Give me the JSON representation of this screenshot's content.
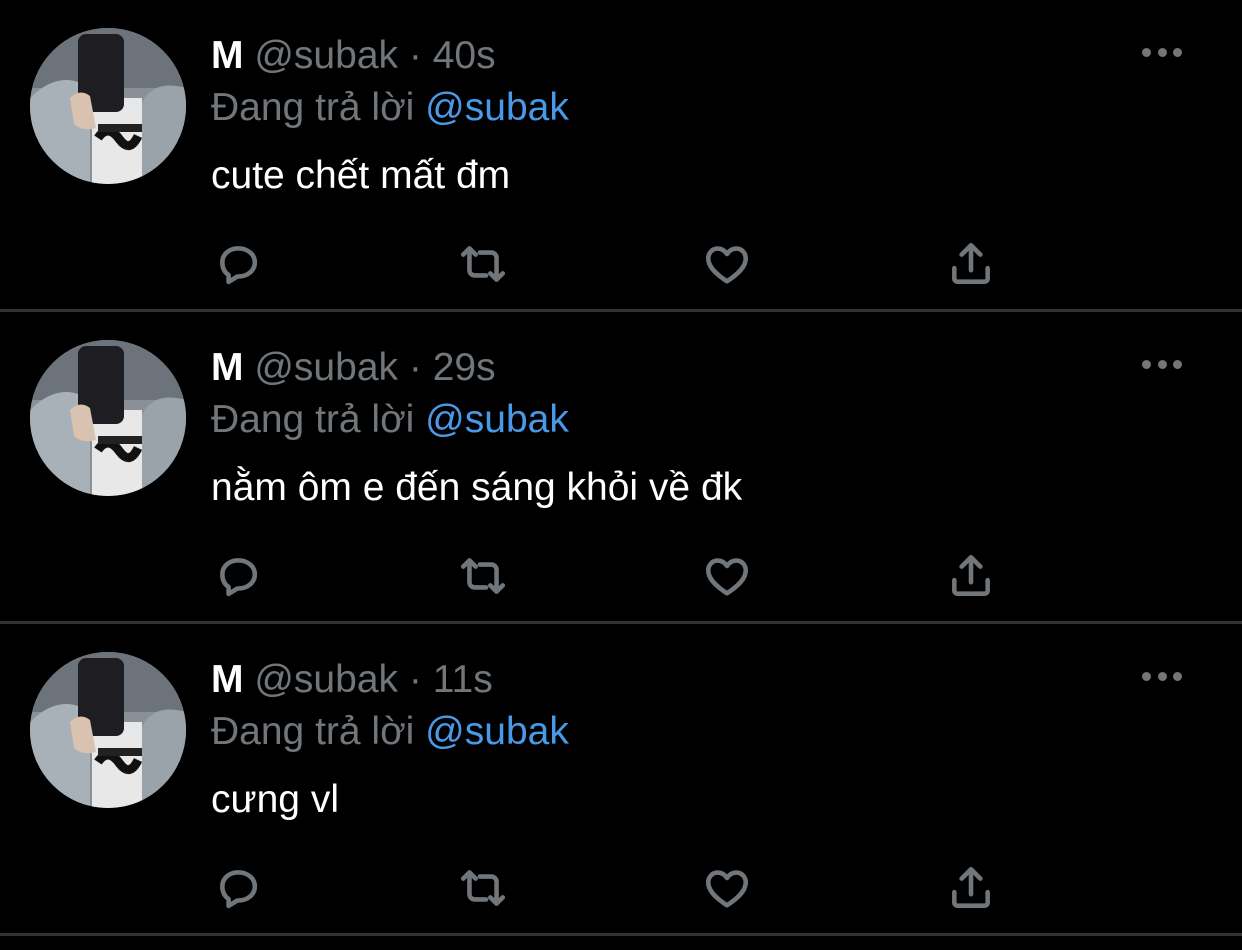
{
  "colors": {
    "background": "#000000",
    "text_primary": "#ffffff",
    "text_secondary": "#71767b",
    "link": "#4a99e9",
    "divider": "#2f3336"
  },
  "tweets": [
    {
      "name": "M",
      "handle": "@subak",
      "separator": "·",
      "time": "40s",
      "reply_prefix": "Đang trả lời",
      "reply_to": "@subak",
      "text": "cute chết mất đm",
      "icons": [
        "reply-icon",
        "retweet-icon",
        "like-icon",
        "share-icon"
      ]
    },
    {
      "name": "M",
      "handle": "@subak",
      "separator": "·",
      "time": "29s",
      "reply_prefix": "Đang trả lời",
      "reply_to": "@subak",
      "text": "nằm ôm e đến sáng khỏi về đk",
      "icons": [
        "reply-icon",
        "retweet-icon",
        "like-icon",
        "share-icon"
      ]
    },
    {
      "name": "M",
      "handle": "@subak",
      "separator": "·",
      "time": "11s",
      "reply_prefix": "Đang trả lời",
      "reply_to": "@subak",
      "text": "cưng vl",
      "icons": [
        "reply-icon",
        "retweet-icon",
        "like-icon",
        "share-icon"
      ]
    }
  ]
}
